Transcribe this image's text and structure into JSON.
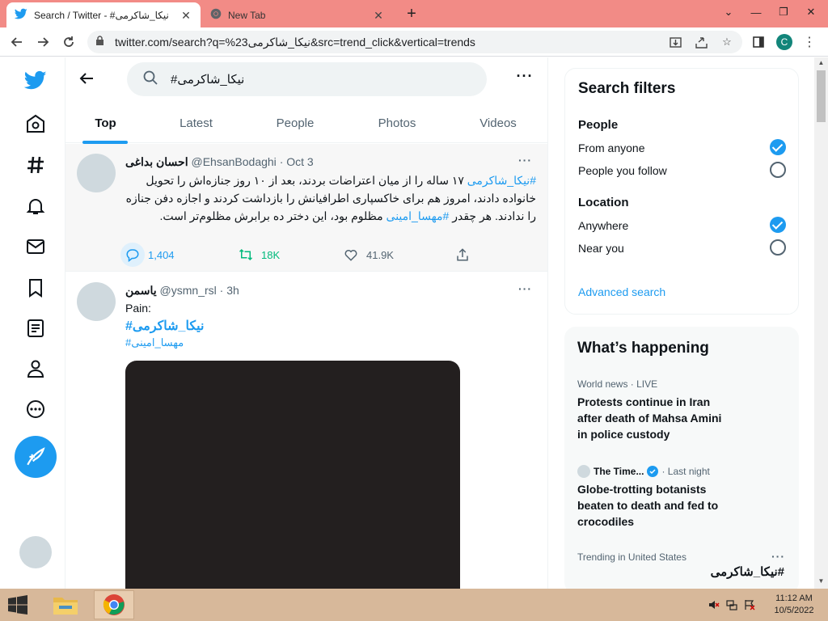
{
  "browser": {
    "tabs": [
      {
        "title": "Search / Twitter - #نیکا_شاکرمی",
        "active": true
      },
      {
        "title": "New Tab",
        "active": false
      }
    ],
    "new_tab": "+",
    "url": "twitter.com/search?q=%23نیکا_شاکرمی&src=trend_click&vertical=trends",
    "profile_initial": "C"
  },
  "search": {
    "query": "#نیکا_شاکرمی",
    "tabs": [
      "Top",
      "Latest",
      "People",
      "Photos",
      "Videos"
    ],
    "active_tab": "Top"
  },
  "tweets": [
    {
      "display_name": "احسان بداغی",
      "handle": "@EhsanBodaghi",
      "time": "Oct 3",
      "hashtag": "#نیکا_شاکرمی",
      "text_a": " ۱۷ ساله را از میان اعتراضات بردند، بعد از ۱۰ روز جنازه‌اش را تحویل خانواده دادند، امروز هم برای خاکسپاری اطرافیانش را بازداشت کردند و اجازه دفن جنازه را ندادند. هر چقدر ",
      "hashtag2": "#مهسا_امینی",
      "text_b": " مظلوم بود، این دختر ده برابرش مظلوم‌تر است.",
      "replies": "1,404",
      "retweets": "18K",
      "likes": "41.9K"
    },
    {
      "display_name": "یاسمن",
      "handle": "@ysmn_rsl",
      "time": "3h",
      "line1": "Pain:",
      "hashtag": "#نیکا_شاکرمی",
      "hashtag2": "#مهسا_امینی"
    }
  ],
  "filters": {
    "title": "Search filters",
    "people_label": "People",
    "people_options": [
      "From anyone",
      "People you follow"
    ],
    "people_selected": 0,
    "location_label": "Location",
    "location_options": [
      "Anywhere",
      "Near you"
    ],
    "location_selected": 0,
    "advanced": "Advanced search"
  },
  "happening": {
    "title": "What’s happening",
    "items": [
      {
        "meta": "World news · LIVE",
        "title": "Protests continue in Iran after death of Mahsa Amini in police custody"
      },
      {
        "source": "The Time...",
        "time": "· Last night",
        "title": "Globe-trotting botanists beaten to death and fed to crocodiles"
      },
      {
        "meta": "Trending in United States",
        "title": "#نیکا_شاکرمی"
      }
    ]
  },
  "taskbar": {
    "time": "11:12 AM",
    "date": "10/5/2022"
  },
  "colors": {
    "accent": "#1d9bf0",
    "titlebar": "#f28b86",
    "taskbar": "#d7b89a",
    "retweet": "#00ba7c"
  }
}
